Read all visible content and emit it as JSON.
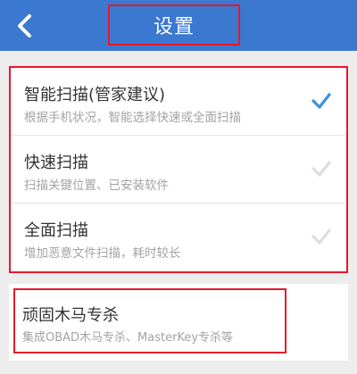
{
  "header": {
    "title": "设置",
    "back_icon": "chevron-left-icon",
    "background_color": "#3b78d0"
  },
  "scan_modes": [
    {
      "title": "智能扫描(管家建议)",
      "description": "根据手机状况，智能选择快速或全面扫描",
      "selected": true
    },
    {
      "title": "快速扫描",
      "description": "扫描关键位置、已安装软件",
      "selected": false
    },
    {
      "title": "全面扫描",
      "description": "增加恶意文件扫描，耗时较长",
      "selected": false
    }
  ],
  "trojan_kill": {
    "title": "顽固木马专杀",
    "description": "集成OBAD木马专杀、MasterKey专杀等"
  },
  "colors": {
    "check_selected": "#3b8fe0",
    "check_unselected": "#dedede",
    "highlight_border": "#e8182c"
  }
}
